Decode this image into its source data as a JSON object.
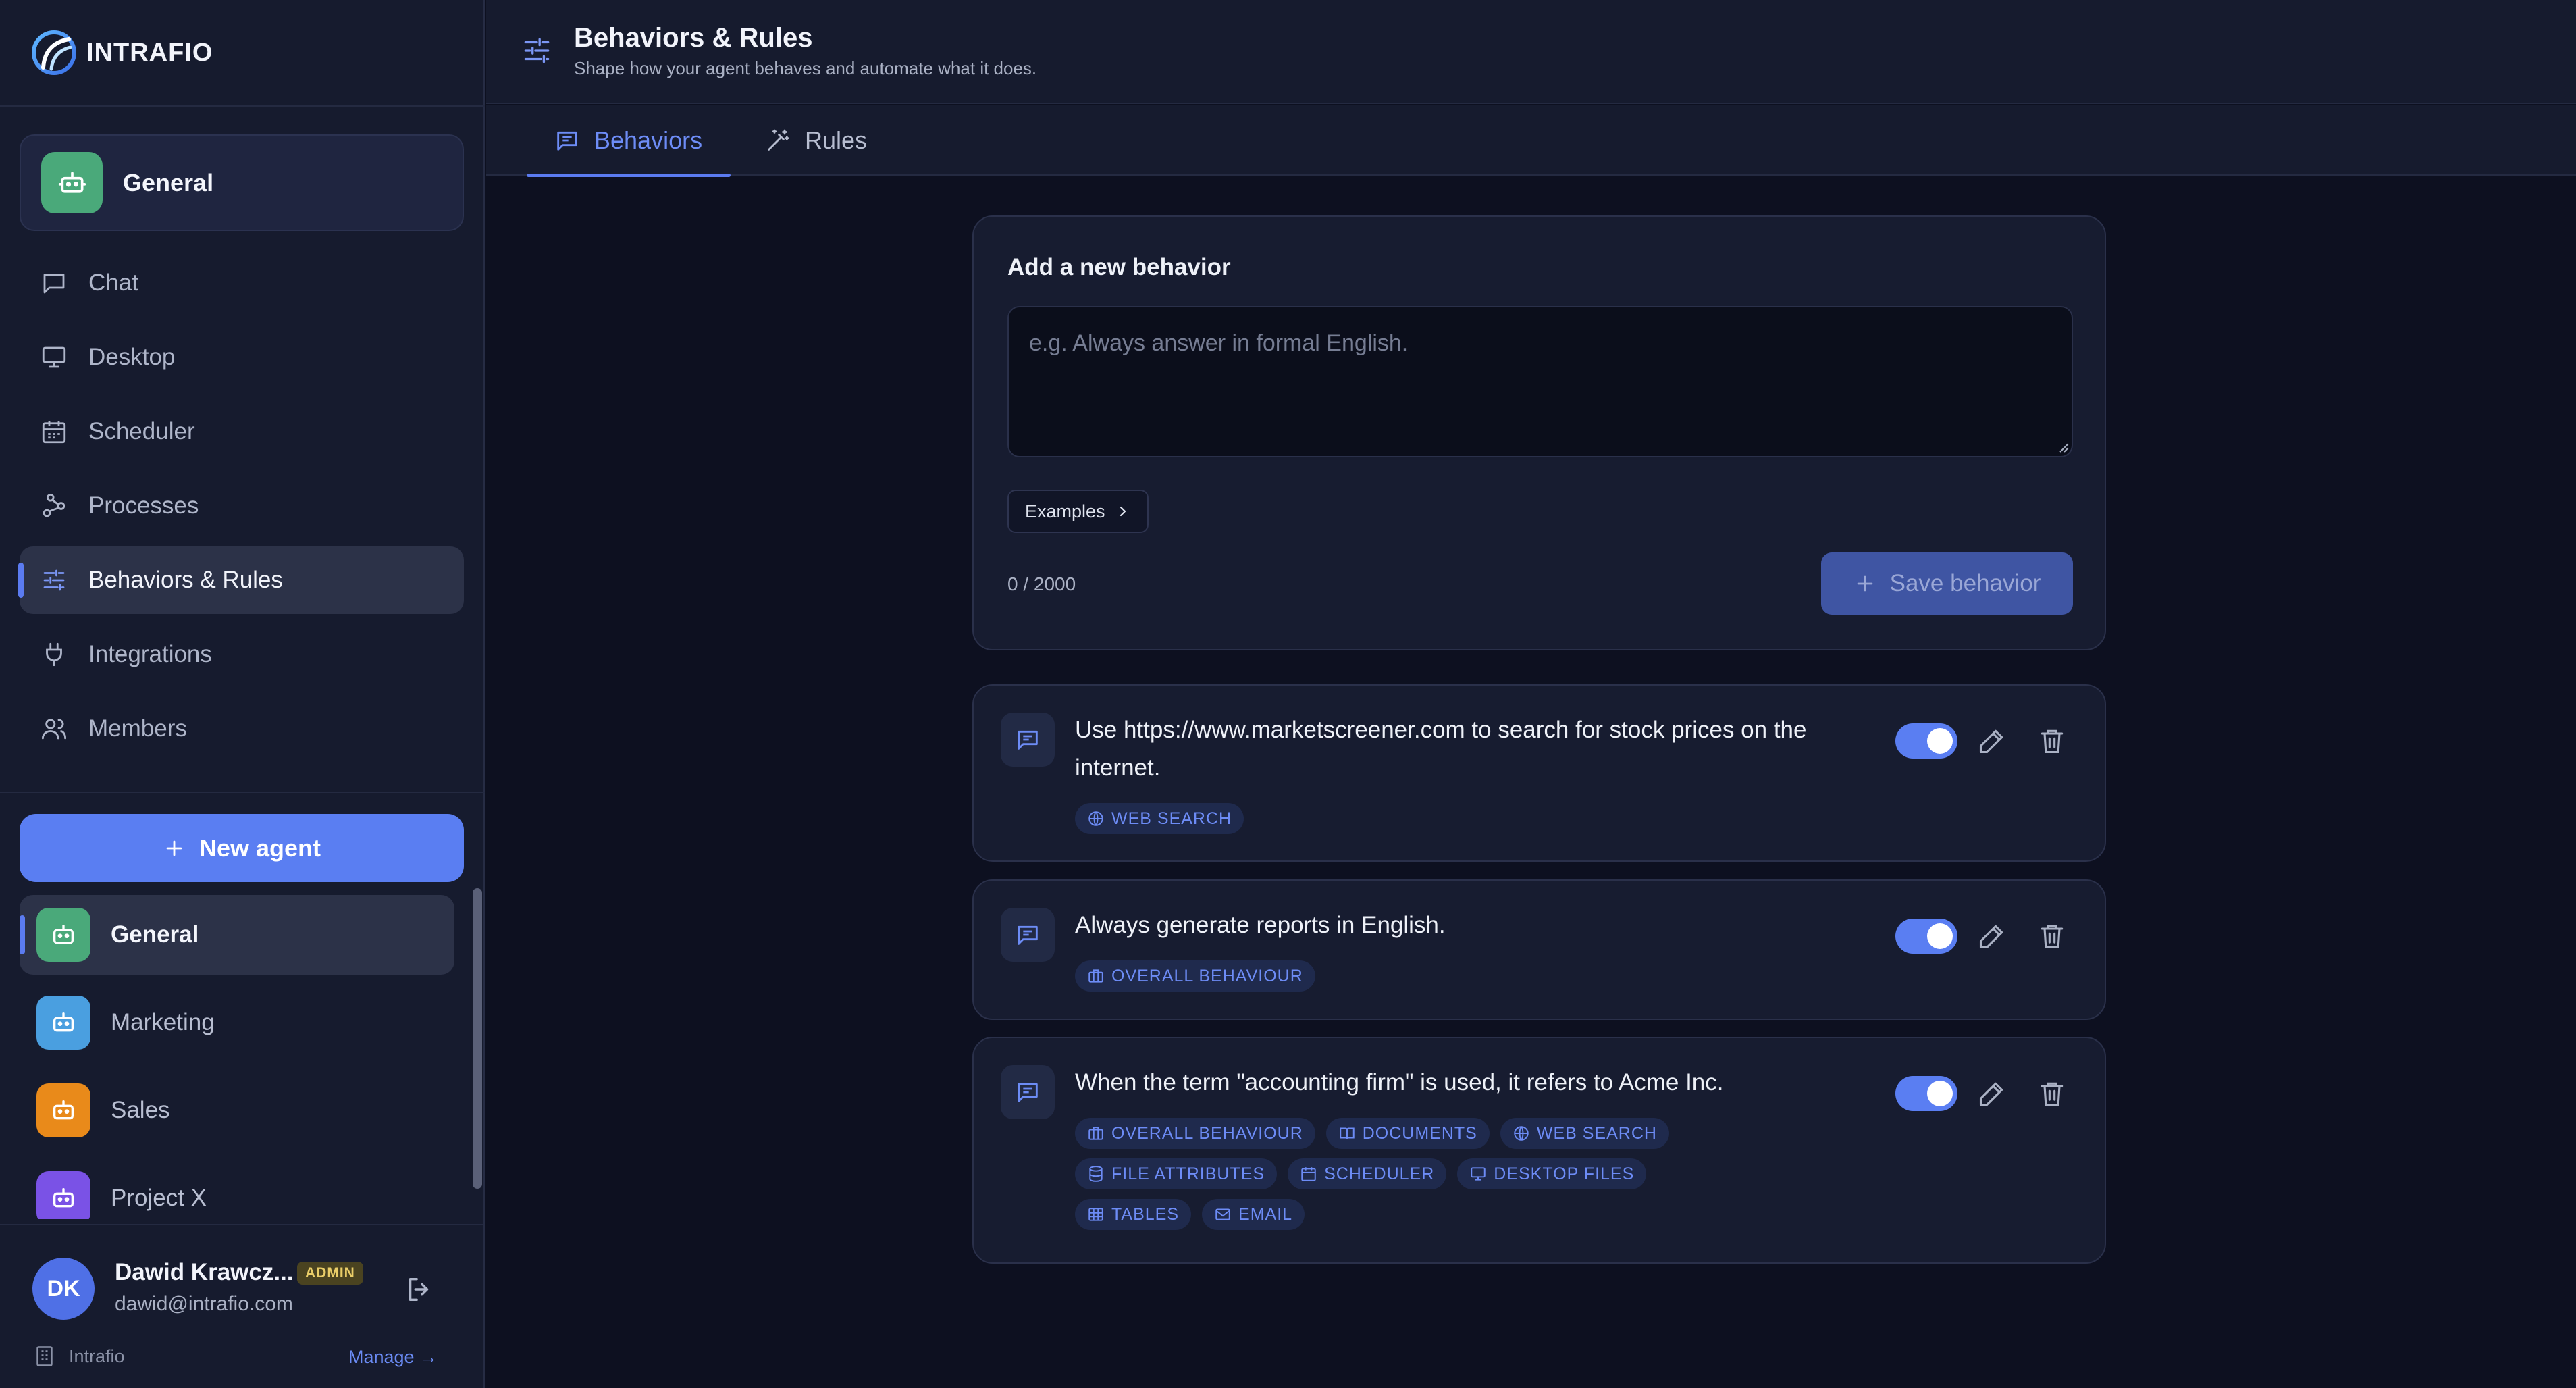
{
  "brand": {
    "name": "INTRAFIO"
  },
  "current_agent": {
    "name": "General",
    "color": "#4aa97a"
  },
  "nav": [
    {
      "label": "Chat",
      "icon": "chat-icon",
      "active": false
    },
    {
      "label": "Desktop",
      "icon": "monitor-icon",
      "active": false
    },
    {
      "label": "Scheduler",
      "icon": "calendar-icon",
      "active": false
    },
    {
      "label": "Processes",
      "icon": "workflow-icon",
      "active": false
    },
    {
      "label": "Behaviors & Rules",
      "icon": "sliders-icon",
      "active": true
    },
    {
      "label": "Integrations",
      "icon": "plug-icon",
      "active": false
    },
    {
      "label": "Members",
      "icon": "users-icon",
      "active": false
    }
  ],
  "new_agent_label": "New agent",
  "agents": [
    {
      "name": "General",
      "color": "#4aa97a",
      "active": true
    },
    {
      "name": "Marketing",
      "color": "#4a9fe0",
      "active": false
    },
    {
      "name": "Sales",
      "color": "#e98a1a",
      "active": false
    },
    {
      "name": "Project X",
      "color": "#7a52e6",
      "active": false
    }
  ],
  "user": {
    "initials": "DK",
    "name": "Dawid Krawcz...",
    "badge": "ADMIN",
    "email": "dawid@intrafio.com",
    "org": "Intrafio",
    "manage_label": "Manage →"
  },
  "header": {
    "title": "Behaviors & Rules",
    "subtitle": "Shape how your agent behaves and automate what it does."
  },
  "tabs": [
    {
      "label": "Behaviors",
      "icon": "message-icon",
      "active": true
    },
    {
      "label": "Rules",
      "icon": "magic-wand-icon",
      "active": false
    }
  ],
  "new_behavior": {
    "title": "Add a new behavior",
    "placeholder": "e.g. Always answer in formal English.",
    "value": "",
    "examples_label": "Examples",
    "char_count": "0 / 2000",
    "save_label": "Save behavior"
  },
  "behaviors": [
    {
      "text": "Use https://www.marketscreener.com to search for stock prices on the internet.",
      "enabled": true,
      "tags": [
        {
          "label": "WEB SEARCH",
          "icon": "globe-icon"
        }
      ]
    },
    {
      "text": "Always generate reports in English.",
      "enabled": true,
      "tags": [
        {
          "label": "OVERALL BEHAVIOUR",
          "icon": "briefcase-icon"
        }
      ]
    },
    {
      "text": "When the term \"accounting firm\" is used, it refers to Acme Inc.",
      "enabled": true,
      "tags": [
        {
          "label": "OVERALL BEHAVIOUR",
          "icon": "briefcase-icon"
        },
        {
          "label": "DOCUMENTS",
          "icon": "book-icon"
        },
        {
          "label": "WEB SEARCH",
          "icon": "globe-icon"
        },
        {
          "label": "FILE ATTRIBUTES",
          "icon": "database-icon"
        },
        {
          "label": "SCHEDULER",
          "icon": "calendar-icon"
        },
        {
          "label": "DESKTOP FILES",
          "icon": "monitor-icon"
        },
        {
          "label": "TABLES",
          "icon": "table-icon"
        },
        {
          "label": "EMAIL",
          "icon": "mail-icon"
        }
      ]
    }
  ],
  "colors": {
    "accent": "#5a7ef2",
    "sidebar_bg": "#161b2e",
    "content_bg": "#0d1020",
    "card_bg": "#171c30",
    "tag_bg": "#1f2a4d",
    "tag_text": "#6d8cf6",
    "admin_badge": "#e9cd68"
  }
}
